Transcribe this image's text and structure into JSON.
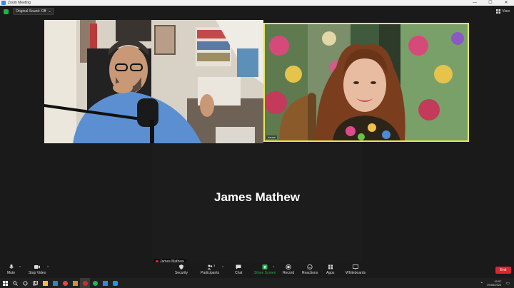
{
  "window": {
    "title": "Zoom Meeting",
    "minimize": "—",
    "maximize": "☐",
    "close": "✕"
  },
  "topbar": {
    "sound_label": "Original Sound: Off",
    "view_label": "View"
  },
  "participants": [
    {
      "video_label": "hanne"
    },
    {
      "name": "James Mathew",
      "tag": "James Mathew"
    }
  ],
  "toolbar": {
    "mute": "Mute",
    "stop_video": "Stop Video",
    "security": "Security",
    "participants": "Participants",
    "participants_count": "3",
    "chat": "Chat",
    "share_screen": "Share Screen",
    "record": "Record",
    "reactions": "Reactions",
    "apps": "Apps",
    "whiteboards": "Whiteboards",
    "end": "End"
  },
  "taskbar": {
    "time": "19:07",
    "date": "09/06/2022"
  },
  "colors": {
    "accent_green": "#23b14d",
    "active_speaker": "#e6e65c",
    "end_red": "#d82828",
    "zoom_blue": "#2d8cff"
  }
}
